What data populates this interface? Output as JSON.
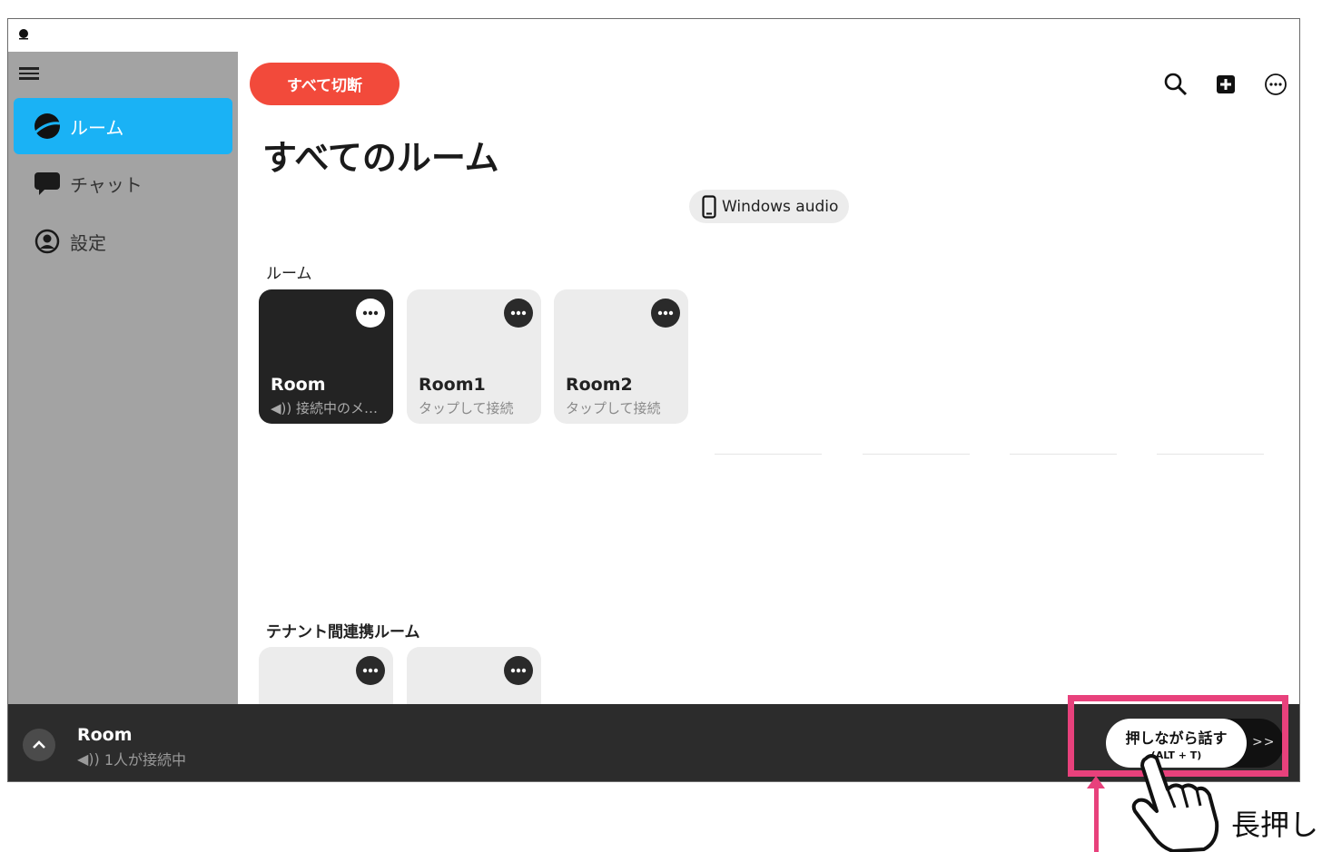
{
  "sidebar": {
    "items": [
      {
        "label": "ルーム",
        "icon": "room-icon",
        "active": true
      },
      {
        "label": "チャット",
        "icon": "chat-bubble-icon",
        "active": false
      },
      {
        "label": "設定",
        "icon": "user-circle-icon",
        "active": false
      }
    ]
  },
  "header": {
    "disconnect_all_label": "すべて切断",
    "icons": [
      "search-icon",
      "add-box-icon",
      "more-circle-icon"
    ]
  },
  "main": {
    "title": "すべてのルーム",
    "audio_device": "Windows audio",
    "rooms_section_label": "ルーム",
    "rooms": [
      {
        "name": "Room",
        "sub": "接続中のメンバ...",
        "active": true
      },
      {
        "name": "Room1",
        "sub": "タップして接続",
        "active": false
      },
      {
        "name": "Room2",
        "sub": "タップして接続",
        "active": false
      }
    ],
    "cross_tenant_section_label": "テナント間連携ルーム"
  },
  "bottom_bar": {
    "room_name": "Room",
    "status": "1人が接続中",
    "ptt_label": "押しながら話す",
    "ptt_shortcut": "(ALT + T)",
    "ptt_arrows": ">>"
  },
  "annotation": {
    "callout_text": "長押し",
    "highlight_color": "#e8417c"
  },
  "colors": {
    "accent": "#1ab2f5",
    "disconnect": "#f24a3b",
    "sidebar_bg": "#a3a3a3",
    "bottom_bar_bg": "#2c2c2c"
  }
}
